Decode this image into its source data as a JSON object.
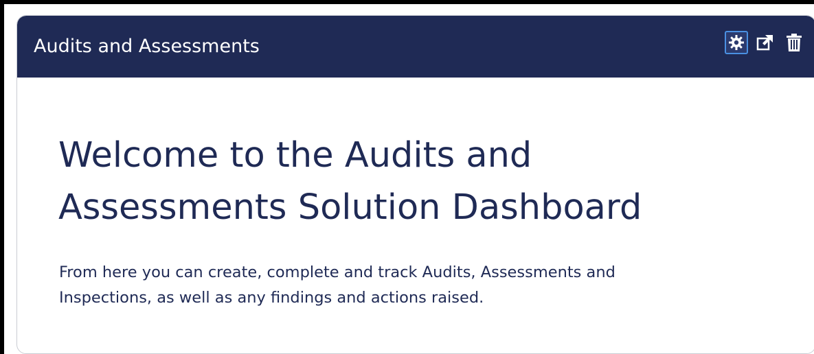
{
  "widget": {
    "title": "Audits and Assessments",
    "tools": [
      {
        "name": "settings",
        "icon": "gear-icon",
        "focused": true
      },
      {
        "name": "pop-out",
        "icon": "external-link-icon",
        "focused": false
      },
      {
        "name": "delete",
        "icon": "trash-icon",
        "focused": false
      }
    ]
  },
  "content": {
    "heading_line1": "Welcome to the Audits and",
    "heading_line2": "Assessments Solution Dashboard",
    "body_line1": "From here you can create, complete and track Audits, Assessments and",
    "body_line2": "Inspections, as well as any findings and actions raised."
  },
  "colors": {
    "header_bg": "#1f2a55",
    "text": "#1f2a55",
    "focus_ring": "#4a90e2"
  }
}
